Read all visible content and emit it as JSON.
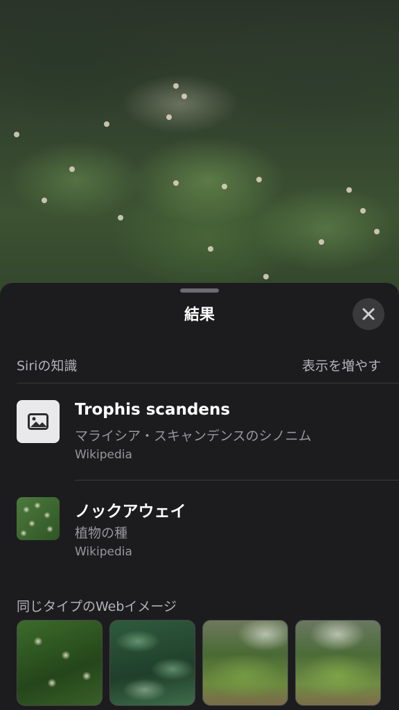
{
  "sheet": {
    "title": "結果",
    "close_icon": "close-icon"
  },
  "siri_knowledge": {
    "section_label": "Siriの知識",
    "more_label": "表示を増やす",
    "results": [
      {
        "title": "Trophis scandens",
        "subtitle": "マライシア・スキャンデンスのシノニム",
        "source": "Wikipedia",
        "thumbnail_icon": "image-placeholder-icon"
      },
      {
        "title": "ノックアウェイ",
        "subtitle": "植物の種",
        "source": "Wikipedia",
        "thumbnail_icon": "plant-photo-thumbnail"
      }
    ]
  },
  "web_images": {
    "section_label": "同じタイプのWebイメージ",
    "count_visible": 4
  },
  "colors": {
    "sheet_background": "#1c1c1e",
    "primary_text": "#ffffff",
    "secondary_text": "#98989d",
    "close_button_bg": "#3a3a3c"
  }
}
